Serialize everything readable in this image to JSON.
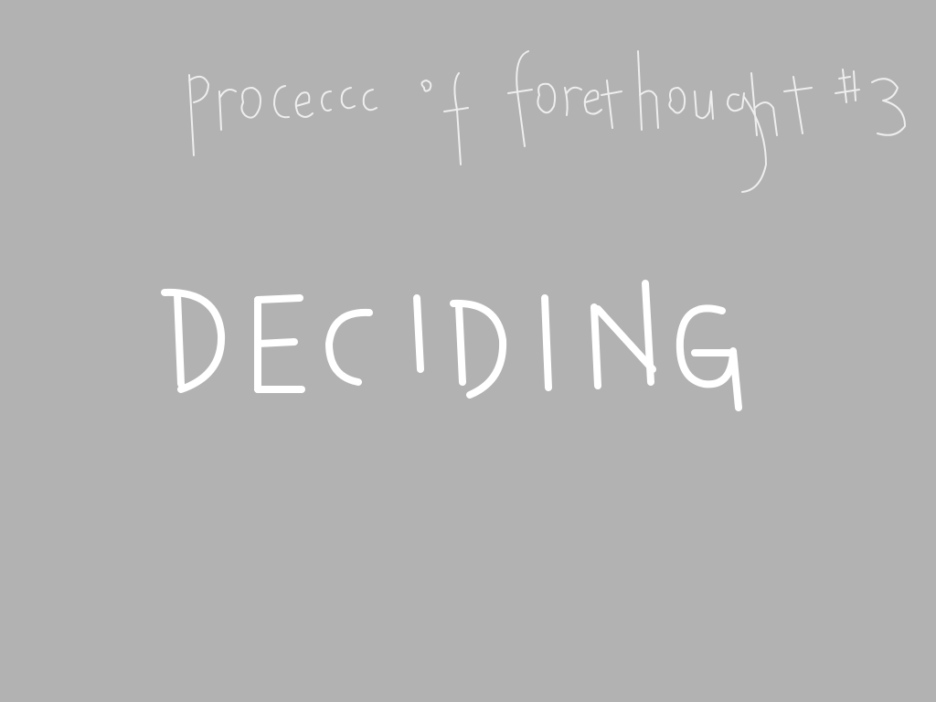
{
  "canvas": {
    "background_color": "#b2b2b2"
  },
  "subtitle": {
    "text": "process of forethought #3",
    "ink_color": "#eeeeee"
  },
  "heading": {
    "text": "DECIDING",
    "ink_color": "#ffffff"
  }
}
